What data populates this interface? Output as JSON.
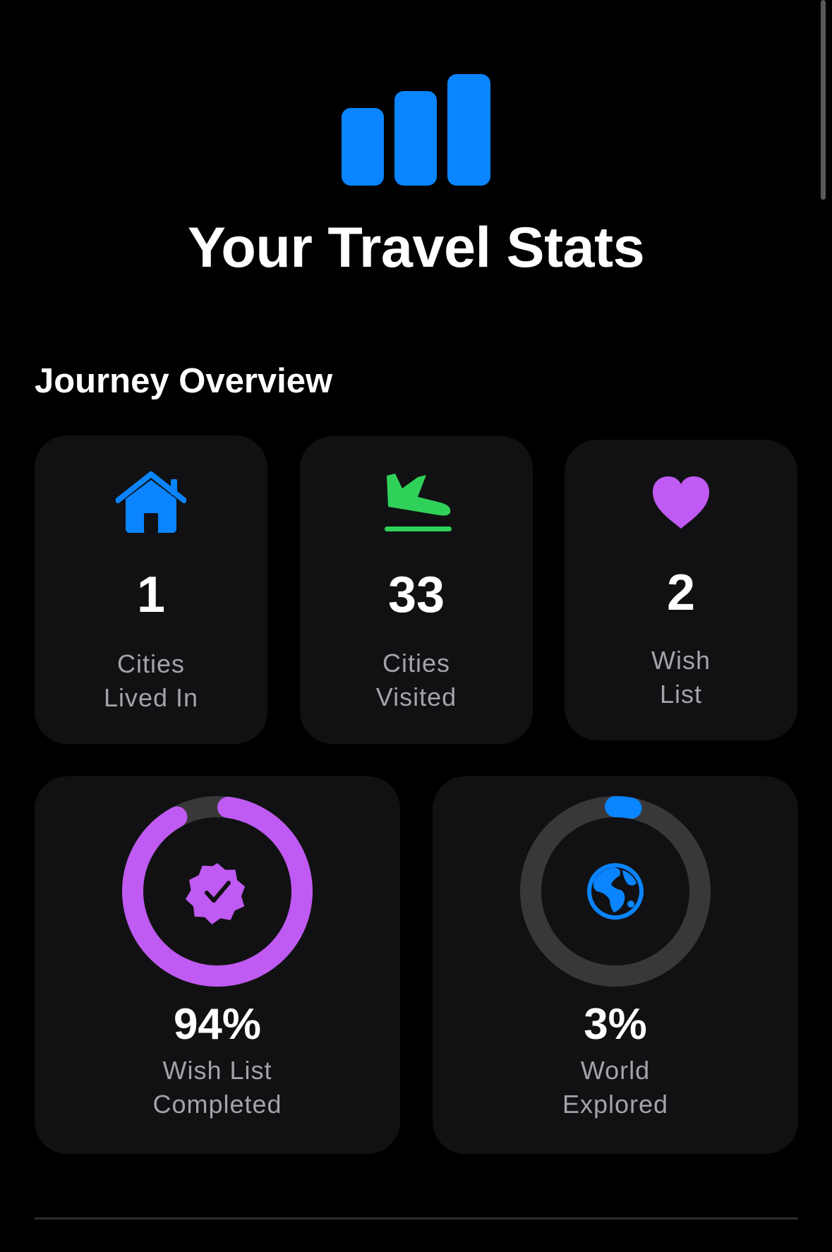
{
  "header": {
    "icon": "chart-bar-icon",
    "title": "Your Travel Stats"
  },
  "section": {
    "title": "Journey Overview"
  },
  "stats": [
    {
      "icon": "house-icon",
      "value": "1",
      "label_line1": "Cities",
      "label_line2": "Lived In",
      "color": "#0a84ff"
    },
    {
      "icon": "airplane-landing-icon",
      "value": "33",
      "label_line1": "Cities",
      "label_line2": "Visited",
      "color": "#30d158"
    },
    {
      "icon": "heart-icon",
      "value": "2",
      "label_line1": "Wish",
      "label_line2": "List",
      "color": "#bf5af2"
    }
  ],
  "progress": [
    {
      "icon": "checkmark-seal-icon",
      "value": "94%",
      "fraction": 0.94,
      "label_line1": "Wish List",
      "label_line2": "Completed",
      "color": "#bf5af2"
    },
    {
      "icon": "globe-icon",
      "value": "3%",
      "fraction": 0.03,
      "label_line1": "World",
      "label_line2": "Explored",
      "color": "#0a84ff"
    }
  ],
  "colors": {
    "accent": "#0a84ff",
    "card": "#111113",
    "ring_track": "#38383a",
    "secondary_text": "#a3a3a8"
  }
}
